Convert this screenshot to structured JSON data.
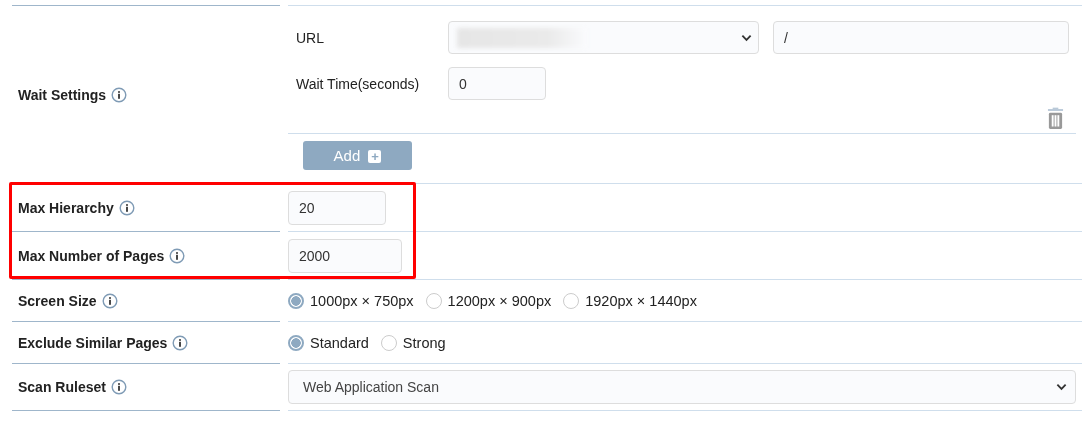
{
  "rows": [
    {
      "kind": "wait",
      "label": "Wait Settings",
      "highlighted": false,
      "entries": [
        {
          "url_label": "URL",
          "path": "/",
          "time_label": "Wait Time(seconds)",
          "time": "0"
        }
      ],
      "add_button": "Add",
      "add_icon": "+"
    },
    {
      "kind": "input",
      "label": "Max Hierarchy",
      "highlighted": true,
      "value": "20"
    },
    {
      "kind": "input",
      "label": "Max Number of Pages",
      "highlighted": true,
      "value": "2000"
    },
    {
      "kind": "radio",
      "label": "Screen Size",
      "highlighted": false,
      "options": [
        {
          "label": "1000px × 750px",
          "selected": true
        },
        {
          "label": "1200px × 900px",
          "selected": false
        },
        {
          "label": "1920px × 1440px",
          "selected": false
        }
      ]
    },
    {
      "kind": "radio",
      "label": "Exclude Similar Pages",
      "highlighted": false,
      "options": [
        {
          "label": "Standard",
          "selected": true
        },
        {
          "label": "Strong",
          "selected": false
        }
      ]
    },
    {
      "kind": "select",
      "label": "Scan Ruleset",
      "highlighted": false,
      "value": "Web Application Scan"
    }
  ]
}
